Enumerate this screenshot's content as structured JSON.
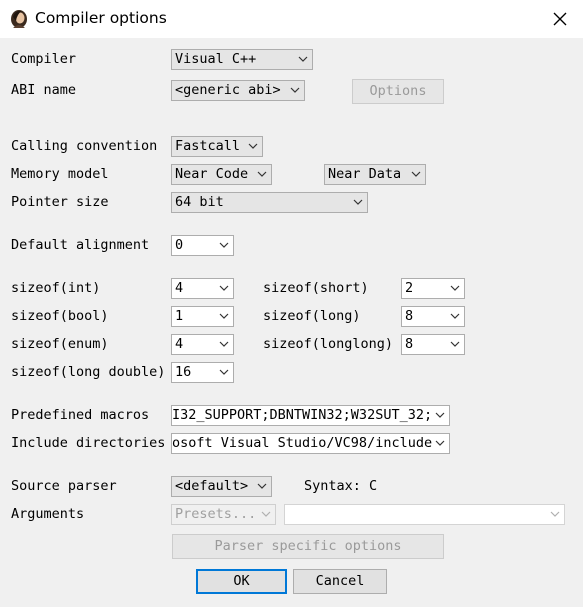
{
  "window": {
    "title": "Compiler options",
    "close_icon": "close-icon",
    "app_icon": "portrait-icon"
  },
  "compiler": {
    "label": "Compiler",
    "value": "Visual C++"
  },
  "abi": {
    "label": "ABI name",
    "value": "<generic abi>",
    "options_button": "Options"
  },
  "calling_convention": {
    "label": "Calling convention",
    "value": "Fastcall"
  },
  "memory_model": {
    "label": "Memory model",
    "code_value": "Near Code",
    "data_value": "Near Data"
  },
  "pointer_size": {
    "label": "Pointer size",
    "value": "64 bit"
  },
  "default_alignment": {
    "label": "Default alignment",
    "value": "0"
  },
  "sizes": {
    "int": {
      "label": "sizeof(int)",
      "value": "4"
    },
    "short": {
      "label": "sizeof(short)",
      "value": "2"
    },
    "bool": {
      "label": "sizeof(bool)",
      "value": "1"
    },
    "long": {
      "label": "sizeof(long)",
      "value": "8"
    },
    "enum": {
      "label": "sizeof(enum)",
      "value": "4"
    },
    "longlong": {
      "label": "sizeof(longlong)",
      "value": "8"
    },
    "long_double": {
      "label": "sizeof(long double)",
      "value": "16"
    }
  },
  "predefined_macros": {
    "label": "Predefined macros",
    "value": "I32_SUPPORT;DBNTWIN32;W32SUT_32;"
  },
  "include_directories": {
    "label": "Include directories",
    "value": "osoft Visual Studio/VC98/include"
  },
  "source_parser": {
    "label": "Source parser",
    "value": "<default>",
    "syntax": "Syntax: C"
  },
  "arguments": {
    "label": "Arguments",
    "presets": "Presets...",
    "value": ""
  },
  "parser_specific_button": "Parser specific options",
  "ok_button": "OK",
  "cancel_button": "Cancel",
  "colors": {
    "accent": "#0078d7",
    "dialog_bg": "#f0f0f0"
  }
}
